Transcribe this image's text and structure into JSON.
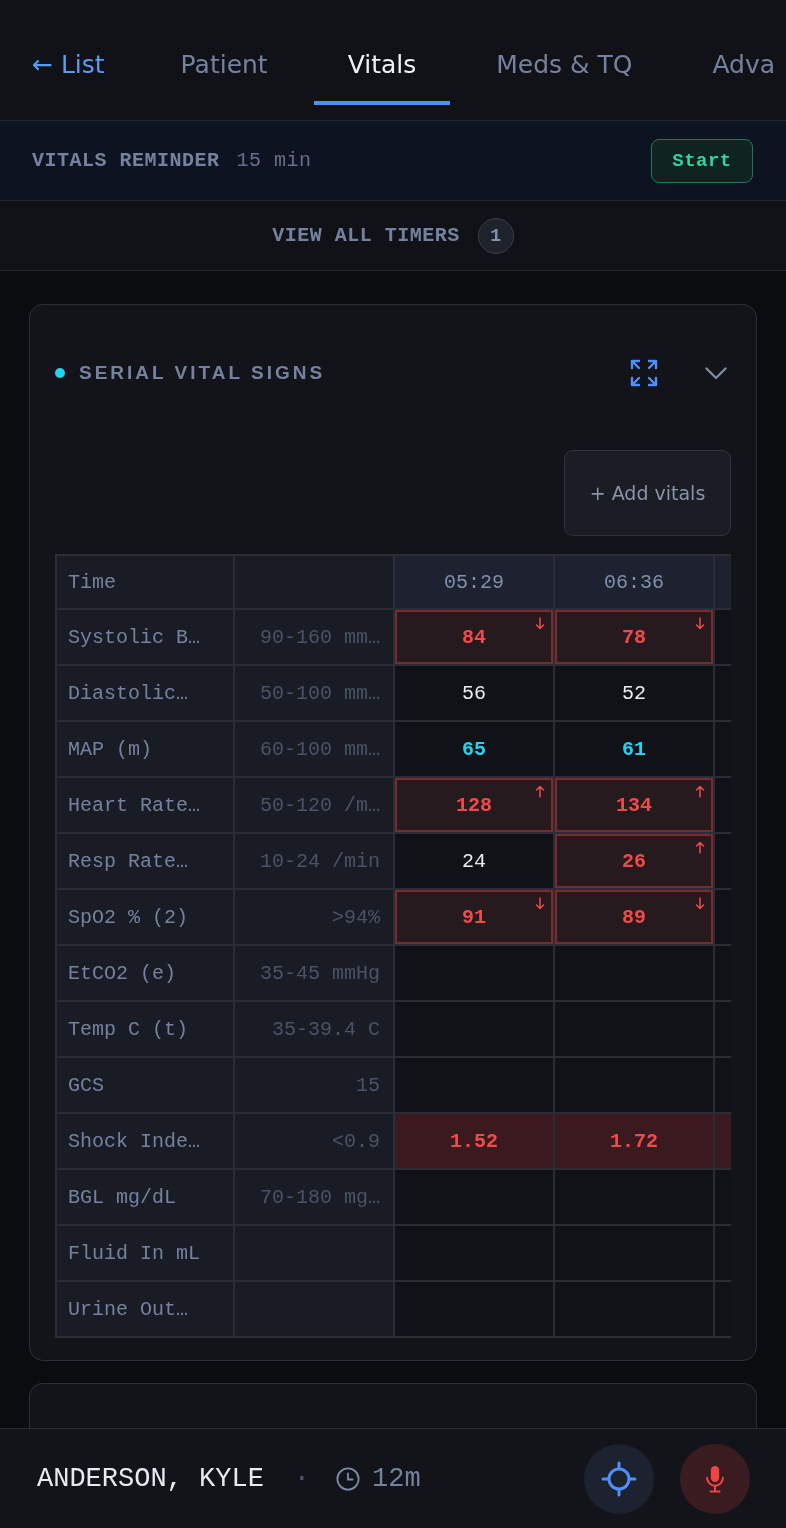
{
  "nav": {
    "back": "← List",
    "tabs": [
      {
        "label": "Patient",
        "selected": false
      },
      {
        "label": "Vitals",
        "selected": true
      },
      {
        "label": "Meds & TQ",
        "selected": false
      },
      {
        "label": "Adva",
        "selected": false
      }
    ]
  },
  "reminder": {
    "label": "VITALS REMINDER",
    "interval": "15 min",
    "button": "Start"
  },
  "timers": {
    "label": "VIEW ALL TIMERS",
    "count": "1"
  },
  "vitals_card": {
    "title": "SERIAL VITAL SIGNS",
    "add_button": "+ Add vitals",
    "table": {
      "corner": "Time",
      "times": [
        "05:29",
        "06:36"
      ],
      "rows": [
        {
          "label": "Systolic B…",
          "range": "90-160 mm…",
          "cells": [
            {
              "value": "84",
              "kind": "low"
            },
            {
              "value": "78",
              "kind": "low"
            },
            {
              "kind": "empty"
            }
          ]
        },
        {
          "label": "Diastolic…",
          "range": "50-100 mm…",
          "cells": [
            {
              "value": "56",
              "kind": "normal"
            },
            {
              "value": "52",
              "kind": "normal"
            },
            {
              "kind": "empty"
            }
          ]
        },
        {
          "label": "MAP (m)",
          "range": "60-100 mm…",
          "cells": [
            {
              "value": "65",
              "kind": "borderline"
            },
            {
              "value": "61",
              "kind": "borderline"
            },
            {
              "kind": "empty"
            }
          ]
        },
        {
          "label": "Heart Rate…",
          "range": "50-120 /m…",
          "cells": [
            {
              "value": "128",
              "kind": "high"
            },
            {
              "value": "134",
              "kind": "high"
            },
            {
              "kind": "empty"
            }
          ]
        },
        {
          "label": "Resp Rate…",
          "range": "10-24 /min",
          "cells": [
            {
              "value": "24",
              "kind": "normal"
            },
            {
              "value": "26",
              "kind": "high"
            },
            {
              "kind": "empty"
            }
          ]
        },
        {
          "label": "SpO2 % (2)",
          "range": ">94%",
          "cells": [
            {
              "value": "91",
              "kind": "low"
            },
            {
              "value": "89",
              "kind": "low"
            },
            {
              "kind": "empty"
            }
          ]
        },
        {
          "label": "EtCO2 (e)",
          "range": "35-45 mmHg",
          "cells": [
            {
              "kind": "empty"
            },
            {
              "kind": "empty"
            },
            {
              "kind": "empty"
            }
          ]
        },
        {
          "label": "Temp C (t)",
          "range": "35-39.4 C",
          "cells": [
            {
              "kind": "empty"
            },
            {
              "kind": "empty"
            },
            {
              "kind": "empty"
            }
          ]
        },
        {
          "label": "GCS",
          "range": "15",
          "cells": [
            {
              "kind": "empty"
            },
            {
              "kind": "empty"
            },
            {
              "kind": "empty"
            }
          ]
        },
        {
          "label": "Shock Inde…",
          "range": "<0.9",
          "cells": [
            {
              "value": "1.52",
              "kind": "critical"
            },
            {
              "value": "1.72",
              "kind": "critical"
            },
            {
              "kind": "critical"
            }
          ]
        },
        {
          "label": "BGL mg/dL",
          "range": "70-180 mg…",
          "cells": [
            {
              "kind": "empty"
            },
            {
              "kind": "empty"
            },
            {
              "kind": "empty"
            }
          ]
        },
        {
          "label": "Fluid In mL",
          "cells": [
            {
              "kind": "empty"
            },
            {
              "kind": "empty"
            },
            {
              "kind": "empty"
            }
          ]
        },
        {
          "label": "Urine Out…",
          "cells": [
            {
              "kind": "empty"
            },
            {
              "kind": "empty"
            },
            {
              "kind": "empty"
            }
          ]
        }
      ]
    }
  },
  "footer": {
    "patient": "ANDERSON, KYLE",
    "separator": "·",
    "elapsed": "12m"
  }
}
